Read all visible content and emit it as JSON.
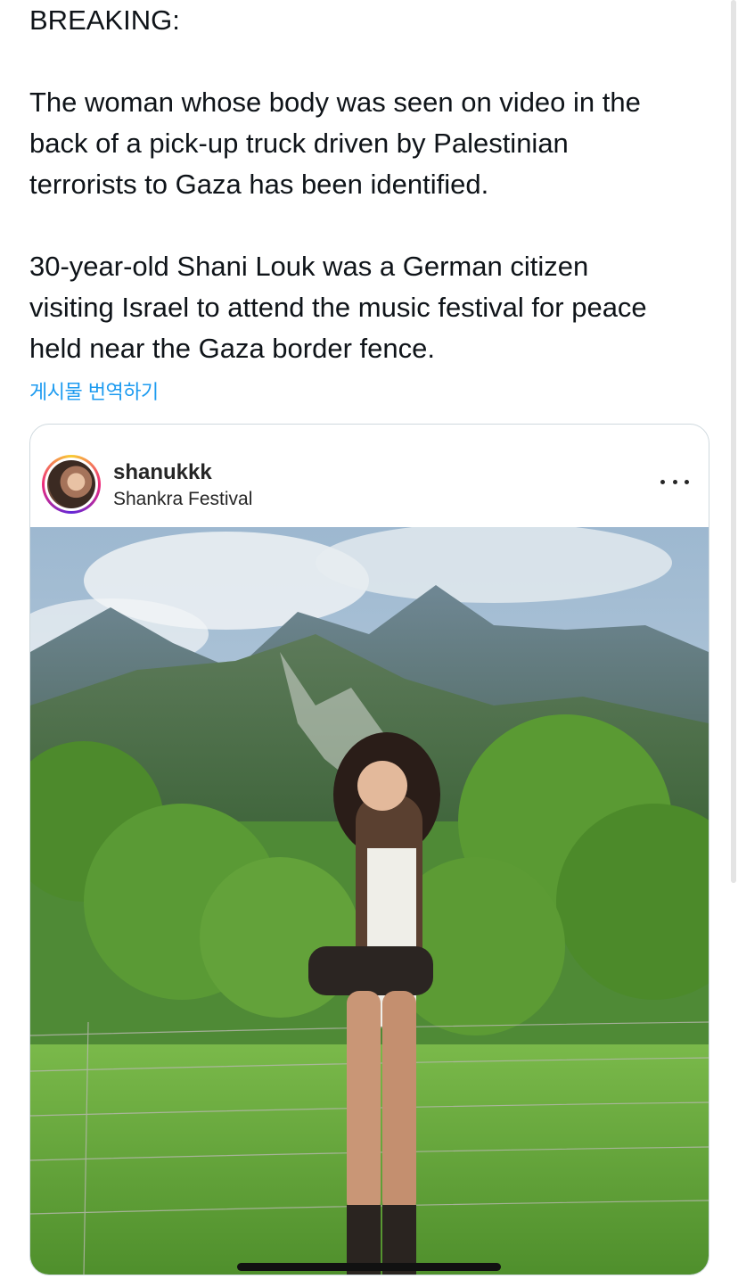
{
  "tweet": {
    "line_breaking": "BREAKING:",
    "paragraph_1": "The woman whose body was seen on video in the\nback of a pick-up truck driven by Palestinian\nterrorists to Gaza has been identified.",
    "paragraph_2": "30-year-old Shani Louk was a German citizen\nvisiting Israel to attend the music festival for peace\nheld near the Gaza border fence.",
    "translate_link": "게시물 번역하기"
  },
  "embed": {
    "username": "shanukkk",
    "location": "Shankra Festival",
    "more_icon": "more-horizontal-icon"
  },
  "colors": {
    "link": "#1d9bf0",
    "text": "#0f1419",
    "border": "#cfd9de"
  }
}
